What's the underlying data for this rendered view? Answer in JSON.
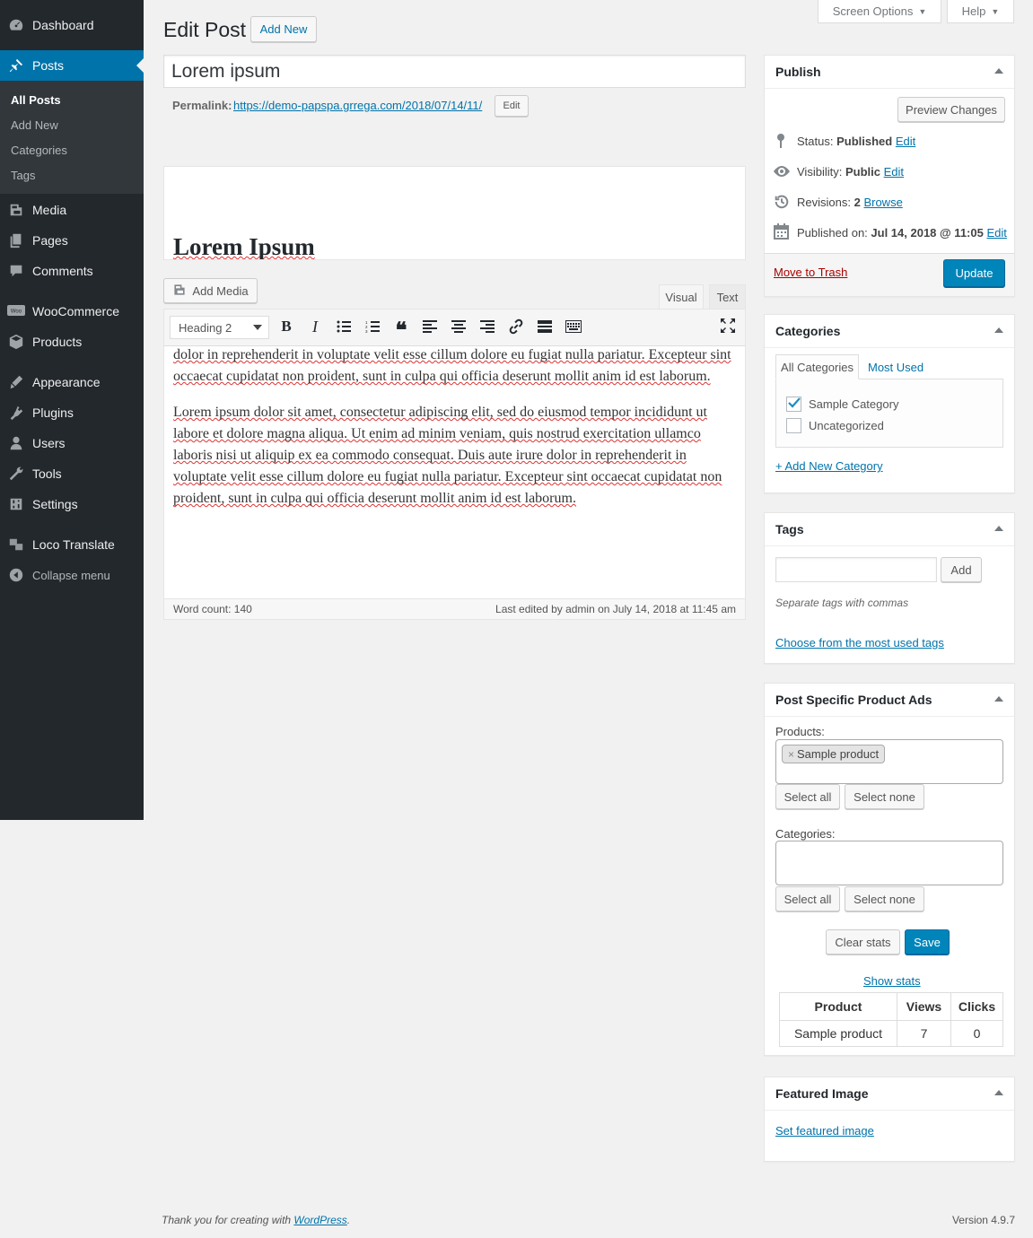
{
  "sidebar": {
    "items": [
      {
        "label": "Dashboard",
        "icon": "dashboard-icon"
      },
      {
        "label": "Posts",
        "icon": "pin-icon"
      },
      {
        "label": "Media",
        "icon": "media-icon"
      },
      {
        "label": "Pages",
        "icon": "pages-icon"
      },
      {
        "label": "Comments",
        "icon": "comments-icon"
      },
      {
        "label": "WooCommerce",
        "icon": "woocommerce-icon"
      },
      {
        "label": "Products",
        "icon": "products-icon"
      },
      {
        "label": "Appearance",
        "icon": "appearance-icon"
      },
      {
        "label": "Plugins",
        "icon": "plugins-icon"
      },
      {
        "label": "Users",
        "icon": "users-icon"
      },
      {
        "label": "Tools",
        "icon": "tools-icon"
      },
      {
        "label": "Settings",
        "icon": "settings-icon"
      },
      {
        "label": "Loco Translate",
        "icon": "translate-icon"
      },
      {
        "label": "Collapse menu",
        "icon": "collapse-icon"
      }
    ],
    "submenu": [
      "All Posts",
      "Add New",
      "Categories",
      "Tags"
    ]
  },
  "topbar": {
    "screen_options": "Screen Options",
    "help": "Help"
  },
  "header": {
    "title": "Edit Post",
    "add_new": "Add New"
  },
  "post": {
    "title": "Lorem ipsum",
    "permalink_label": "Permalink:",
    "permalink_url": "https://demo-papspa.grrega.com/2018/07/14/11/",
    "permalink_edit": "Edit",
    "preview_heading": "Lorem Ipsum"
  },
  "editor": {
    "add_media": "Add Media",
    "tab_visual": "Visual",
    "tab_text": "Text",
    "format": "Heading 2",
    "para1": "dolor in reprehenderit in voluptate velit esse cillum dolore eu fugiat nulla pariatur. Excepteur sint occaecat cupidatat non proident, sunt in culpa qui officia deserunt mollit anim id est laborum.",
    "para2": "Lorem ipsum dolor sit amet, consectetur adipiscing elit, sed do eiusmod tempor incididunt ut labore et dolore magna aliqua. Ut enim ad minim veniam, quis nostrud exercitation ullamco laboris nisi ut aliquip ex ea commodo consequat. Duis aute irure dolor in reprehenderit in voluptate velit esse cillum dolore eu fugiat nulla pariatur. Excepteur sint occaecat cupidatat non proident, sunt in culpa qui officia deserunt mollit anim id est laborum.",
    "word_count": "Word count: 140",
    "last_edited": "Last edited by admin on July 14, 2018 at 11:45 am"
  },
  "publish": {
    "title": "Publish",
    "preview": "Preview Changes",
    "status_label": "Status:",
    "status_value": "Published",
    "visibility_label": "Visibility:",
    "visibility_value": "Public",
    "revisions_label": "Revisions:",
    "revisions_value": "2",
    "browse": "Browse",
    "published_label": "Published on:",
    "published_value": "Jul 14, 2018 @ 11:05",
    "edit": "Edit",
    "trash": "Move to Trash",
    "update": "Update"
  },
  "categories": {
    "title": "Categories",
    "tab_all": "All Categories",
    "tab_most": "Most Used",
    "items": [
      {
        "label": "Sample Category",
        "checked": true
      },
      {
        "label": "Uncategorized",
        "checked": false
      }
    ],
    "add_new": "+ Add New Category"
  },
  "tags": {
    "title": "Tags",
    "add": "Add",
    "hint": "Separate tags with commas",
    "choose": "Choose from the most used tags"
  },
  "ads": {
    "title": "Post Specific Product Ads",
    "products_label": "Products:",
    "product_token": "Sample product",
    "select_all": "Select all",
    "select_none": "Select none",
    "categories_label": "Categories:",
    "clear_stats": "Clear stats",
    "save": "Save",
    "show_stats": "Show stats",
    "table": {
      "headers": [
        "Product",
        "Views",
        "Clicks"
      ],
      "rows": [
        [
          "Sample product",
          "7",
          "0"
        ]
      ]
    }
  },
  "featured": {
    "title": "Featured Image",
    "set": "Set featured image"
  },
  "footer": {
    "thanks_prefix": "Thank you for creating with",
    "wp": "WordPress",
    "thanks_suffix": ".",
    "version": "Version 4.9.7"
  },
  "colors": {
    "sidebar": "#23282d",
    "accent": "#0073aa",
    "primary_button": "#0085ba",
    "trash": "#a00"
  }
}
